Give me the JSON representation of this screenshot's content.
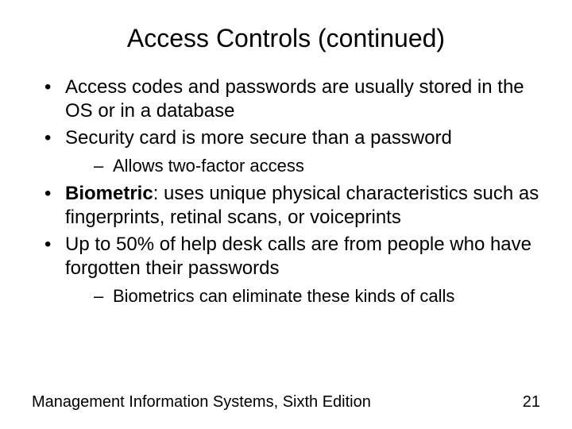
{
  "title": "Access Controls (continued)",
  "bullets": {
    "b1": "Access codes and passwords are usually stored in the OS or in a database",
    "b2": "Security card is more secure than a password",
    "b2_sub": "Allows two-factor access",
    "b3_lead": "Biometric",
    "b3_rest": ": uses unique physical characteristics such as fingerprints, retinal scans, or voiceprints",
    "b4": "Up to 50% of help desk calls are from people who have forgotten their passwords",
    "b4_sub": "Biometrics can eliminate these kinds of calls"
  },
  "footer": {
    "source": "Management Information Systems, Sixth Edition",
    "page": "21"
  }
}
